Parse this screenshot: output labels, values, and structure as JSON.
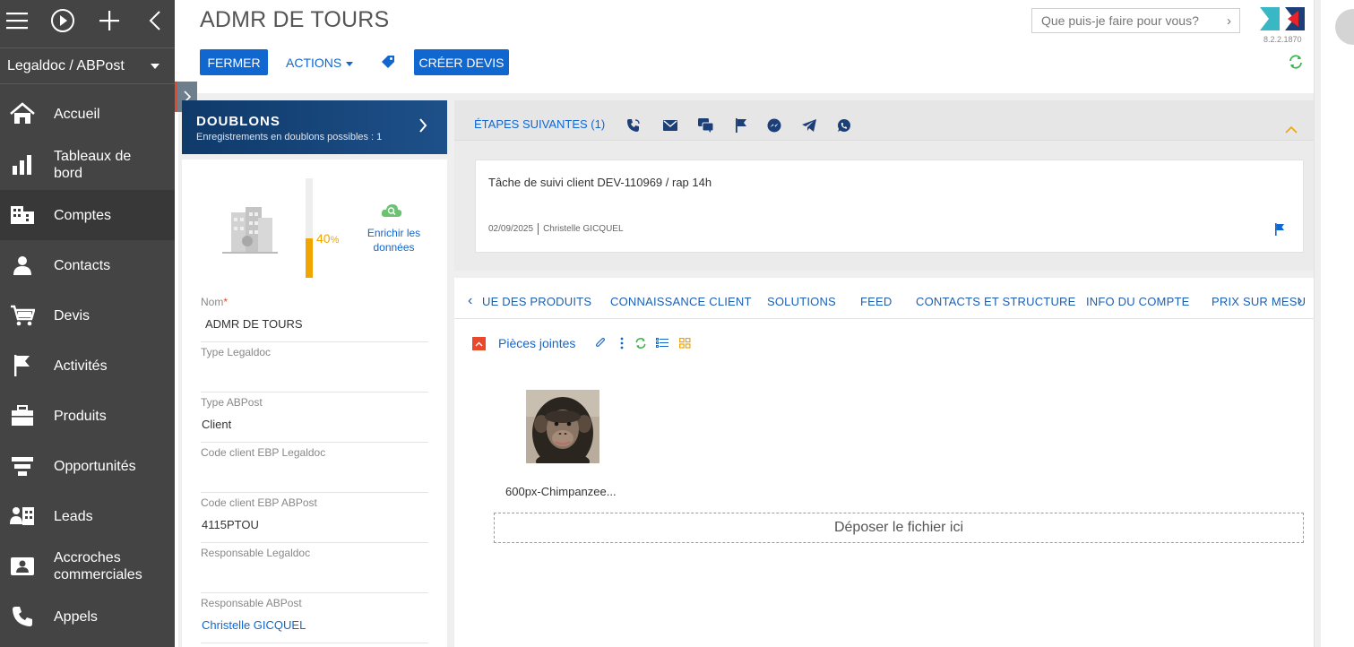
{
  "sidebar": {
    "workspace": "Legaldoc / ABPost",
    "items": [
      {
        "label": "Accueil",
        "icon": "home-icon"
      },
      {
        "label": "Tableaux de\nbord",
        "icon": "dashboard-icon"
      },
      {
        "label": "Comptes",
        "icon": "accounts-icon"
      },
      {
        "label": "Contacts",
        "icon": "contact-icon"
      },
      {
        "label": "Devis",
        "icon": "cart-icon"
      },
      {
        "label": "Activités",
        "icon": "flag-icon"
      },
      {
        "label": "Produits",
        "icon": "products-icon"
      },
      {
        "label": "Opportunités",
        "icon": "funnel-icon"
      },
      {
        "label": "Leads",
        "icon": "leads-icon"
      },
      {
        "label": "Accroches\ncommerciales",
        "icon": "pitch-icon"
      },
      {
        "label": "Appels",
        "icon": "phone-icon"
      }
    ]
  },
  "header": {
    "title": "ADMR DE TOURS",
    "close_label": "FERMER",
    "actions_label": "ACTIONS",
    "create_quote_label": "CRÉER DEVIS",
    "search_placeholder": "Que puis-je faire pour vous?",
    "version": "8.2.2.1870"
  },
  "duplicates": {
    "title": "DOUBLONS",
    "subtitle": "Enregistrements en doublons possibles : 1"
  },
  "completeness": {
    "percent_value": 40,
    "percent_text": "40",
    "percent_sign": "%",
    "enrich_label": "Enrichir les données"
  },
  "fields": [
    {
      "label": "Nom",
      "required_mark": "*",
      "value": "ADMR DE TOURS"
    },
    {
      "label": "Type Legaldoc",
      "value": ""
    },
    {
      "label": "Type ABPost",
      "value": "Client"
    },
    {
      "label": "Code client EBP Legaldoc",
      "value": ""
    },
    {
      "label": "Code client EBP ABPost",
      "value": "4115PTOU"
    },
    {
      "label": "Responsable Legaldoc",
      "value": ""
    },
    {
      "label": "Responsable ABPost",
      "value": "Christelle GICQUEL"
    }
  ],
  "next_steps": {
    "title": "ÉTAPES SUIVANTES (1)",
    "task": {
      "title": "Tâche de suivi client DEV-110969 / rap 14h",
      "date": "02/09/2025",
      "owner": "Christelle GICQUEL"
    }
  },
  "tabs": [
    "UE DES PRODUITS",
    "CONNAISSANCE CLIENT",
    "SOLUTIONS",
    "FEED",
    "CONTACTS ET STRUCTURE",
    "INFO DU COMPTE",
    "PRIX SUR MESU"
  ],
  "attachments": {
    "title": "Pièces jointes",
    "file_name": "600px-Chimpanzee...",
    "dropzone": "Déposer le fichier ici"
  },
  "colors": {
    "primary": "#1167d0",
    "sidebar": "#444444",
    "accent_orange": "#f0a500",
    "danger": "#e8482b",
    "refresh_green": "#3bb44a"
  }
}
